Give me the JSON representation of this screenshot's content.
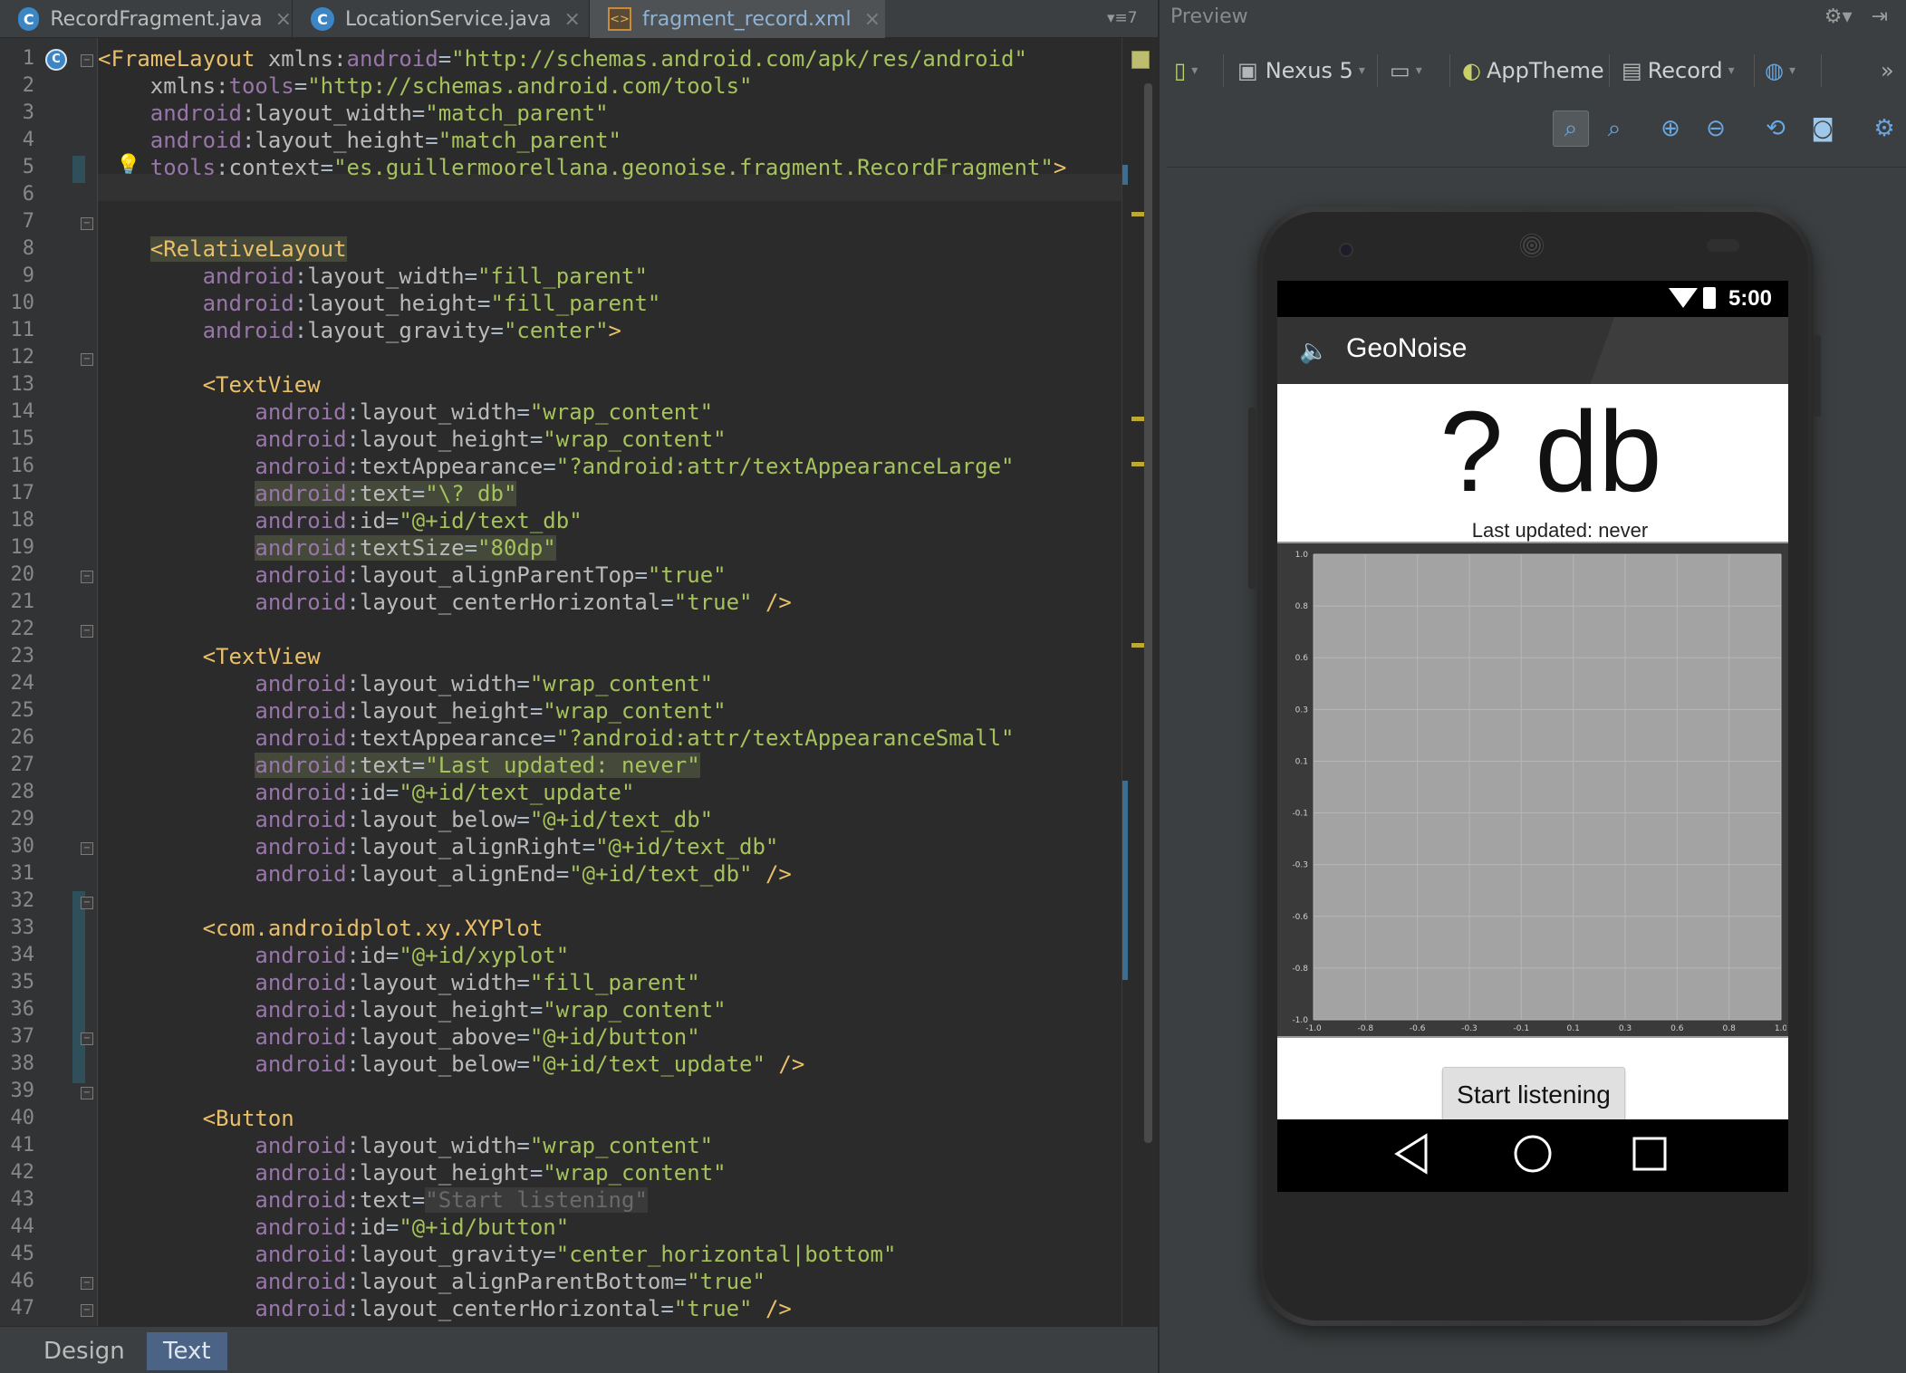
{
  "tabs": [
    {
      "label": "RecordFragment.java",
      "icon": "java-class-icon",
      "active": false
    },
    {
      "label": "LocationService.java",
      "icon": "java-class-icon",
      "active": false
    },
    {
      "label": "fragment_record.xml",
      "icon": "xml-file-icon",
      "active": true
    }
  ],
  "tab_overflow_count": "7",
  "editor": {
    "line_numbers": [
      "1",
      "2",
      "3",
      "4",
      "5",
      "6",
      "7",
      "8",
      "9",
      "10",
      "11",
      "12",
      "13",
      "14",
      "15",
      "16",
      "17",
      "18",
      "19",
      "20",
      "21",
      "22",
      "23",
      "24",
      "25",
      "26",
      "27",
      "28",
      "29",
      "30",
      "31",
      "32",
      "33",
      "34",
      "35",
      "36",
      "37",
      "38",
      "39",
      "40",
      "41",
      "42",
      "43",
      "44",
      "45",
      "46",
      "47"
    ]
  },
  "bottom_tabs": {
    "design": "Design",
    "text": "Text"
  },
  "preview": {
    "title": "Preview",
    "toolbar": {
      "device": "Nexus 5",
      "theme": "AppTheme",
      "activity": "Record"
    }
  },
  "phone": {
    "time": "5:00",
    "app_title": "GeoNoise",
    "db_text": "? db",
    "last_updated": "Last updated: never",
    "button_label": "Start listening",
    "plot_y_ticks": [
      "1.0",
      "0.8",
      "0.6",
      "0.3",
      "0.1",
      "-0.1",
      "-0.3",
      "-0.6",
      "-0.8",
      "-1.0"
    ],
    "plot_x_ticks": [
      "-1.0",
      "-0.8",
      "-0.6",
      "-0.3",
      "-0.1",
      "0.1",
      "0.3",
      "0.6",
      "0.8",
      "1.0"
    ]
  },
  "colors": {
    "editor_bg": "#2b2b2b",
    "tag": "#e8bf6a",
    "attr_value": "#a5c25c",
    "namespace": "#9876aa",
    "plot_bg": "#a3a3a3"
  }
}
